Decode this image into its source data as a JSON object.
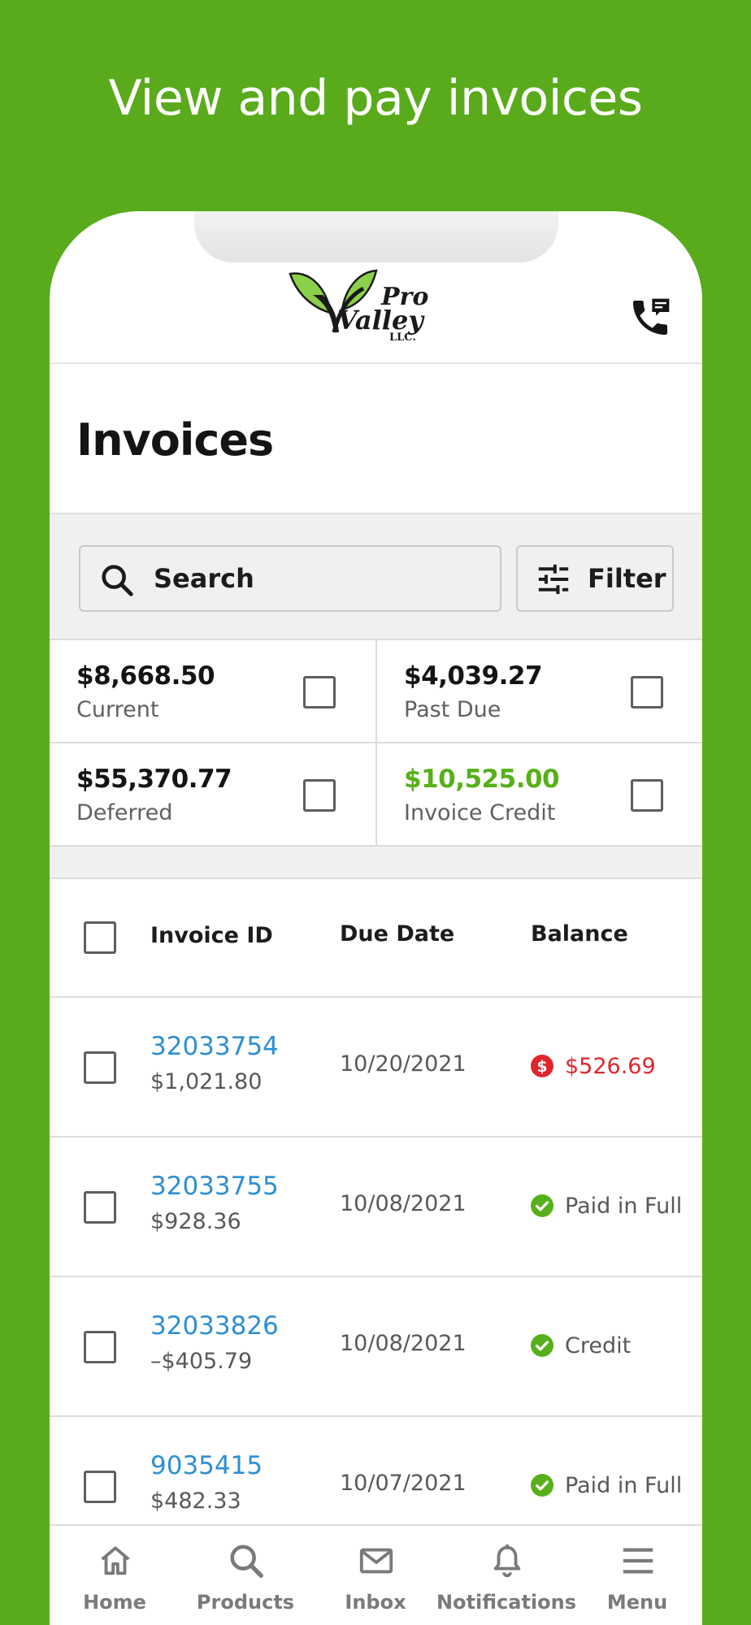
{
  "headline": "View and pay invoices",
  "brand": {
    "logo_line1": "Pro",
    "logo_line2": "Valley",
    "logo_line3": "LLC."
  },
  "page": {
    "title": "Invoices"
  },
  "toolbar": {
    "search_label": "Search",
    "filter_label": "Filter"
  },
  "summary": [
    {
      "amount": "$8,668.50",
      "label": "Current",
      "color": "#141414"
    },
    {
      "amount": "$4,039.27",
      "label": "Past Due",
      "color": "#141414"
    },
    {
      "amount": "$55,370.77",
      "label": "Deferred",
      "color": "#141414"
    },
    {
      "amount": "$10,525.00",
      "label": "Invoice Credit",
      "color": "#57b01a"
    }
  ],
  "table": {
    "headers": {
      "invoice_id": "Invoice ID",
      "due_date": "Due Date",
      "balance": "Balance"
    },
    "rows": [
      {
        "id": "32033754",
        "amount": "$1,021.80",
        "due": "10/20/2021",
        "balance": "$526.69",
        "status_icon": "dollar-alert-icon"
      },
      {
        "id": "32033755",
        "amount": "$928.36",
        "due": "10/08/2021",
        "balance": "Paid in Full",
        "status_icon": "check-circle-icon"
      },
      {
        "id": "32033826",
        "amount": "–$405.79",
        "due": "10/08/2021",
        "balance": "Credit",
        "status_icon": "check-circle-icon"
      },
      {
        "id": "9035415",
        "amount": "$482.33",
        "due": "10/07/2021",
        "balance": "Paid in Full",
        "status_icon": "check-circle-icon"
      }
    ]
  },
  "tabs": [
    {
      "label": "Home",
      "icon": "home-icon"
    },
    {
      "label": "Products",
      "icon": "search-icon"
    },
    {
      "label": "Inbox",
      "icon": "mail-icon"
    },
    {
      "label": "Notifications",
      "icon": "bell-icon"
    },
    {
      "label": "Menu",
      "icon": "menu-icon"
    }
  ],
  "colors": {
    "brand_green": "#5aab1c",
    "link_blue": "#2e8fd3",
    "alert_red": "#e0262b",
    "success_green": "#57b01a"
  }
}
